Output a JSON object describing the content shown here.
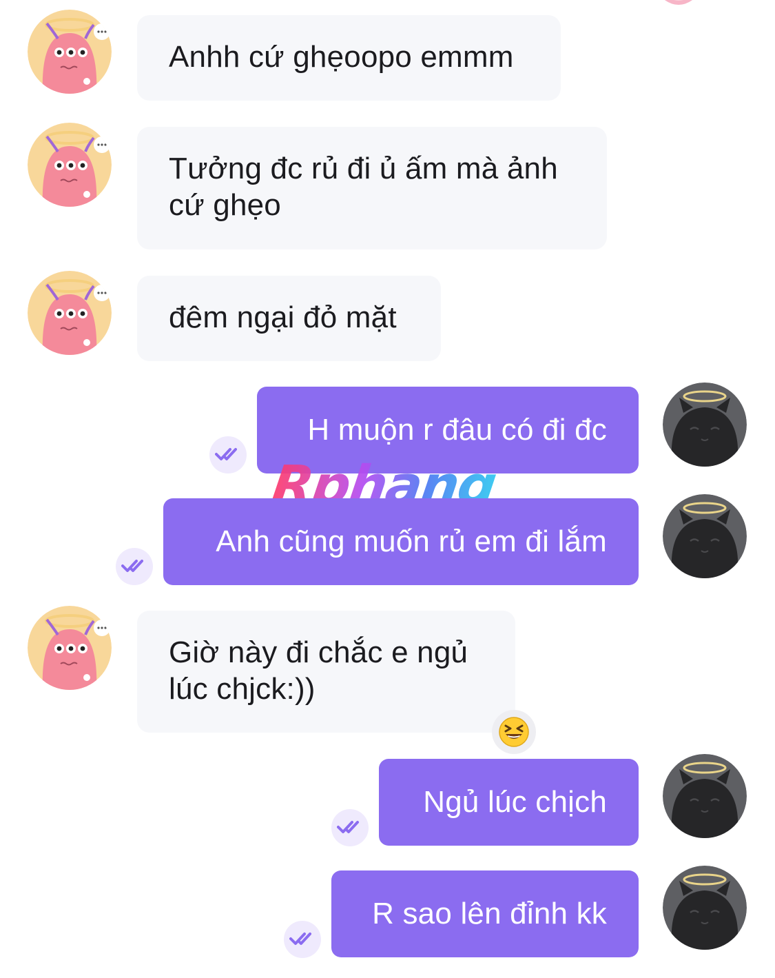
{
  "watermark": "Rphang",
  "messages": [
    {
      "side": "in",
      "text": "Anhh cứ ghẹoopo emmm"
    },
    {
      "side": "in",
      "text": "Tưởng đc rủ đi ủ ấm mà ảnh cứ ghẹo"
    },
    {
      "side": "in",
      "text": "đêm ngại đỏ mặt"
    },
    {
      "side": "out",
      "text": "H muộn r đâu có đi đc"
    },
    {
      "side": "out",
      "text": "Anh cũng muốn rủ em đi lắm"
    },
    {
      "side": "in",
      "text": "Giờ này đi chắc e ngủ lúc chjck:))",
      "reaction": "😆"
    },
    {
      "side": "out",
      "text": "Ngủ lúc chịch"
    },
    {
      "side": "out",
      "text": "R sao lên đỉnh kk"
    }
  ],
  "colors": {
    "outgoing_bubble": "#8b6cf0",
    "incoming_bubble": "#f6f7fa",
    "read_receipt": "#8b6cf0"
  },
  "icons": {
    "incoming_avatar": "pink-monster-avatar-icon",
    "outgoing_avatar": "dark-cat-halo-avatar-icon",
    "read_receipt": "double-check-icon"
  }
}
